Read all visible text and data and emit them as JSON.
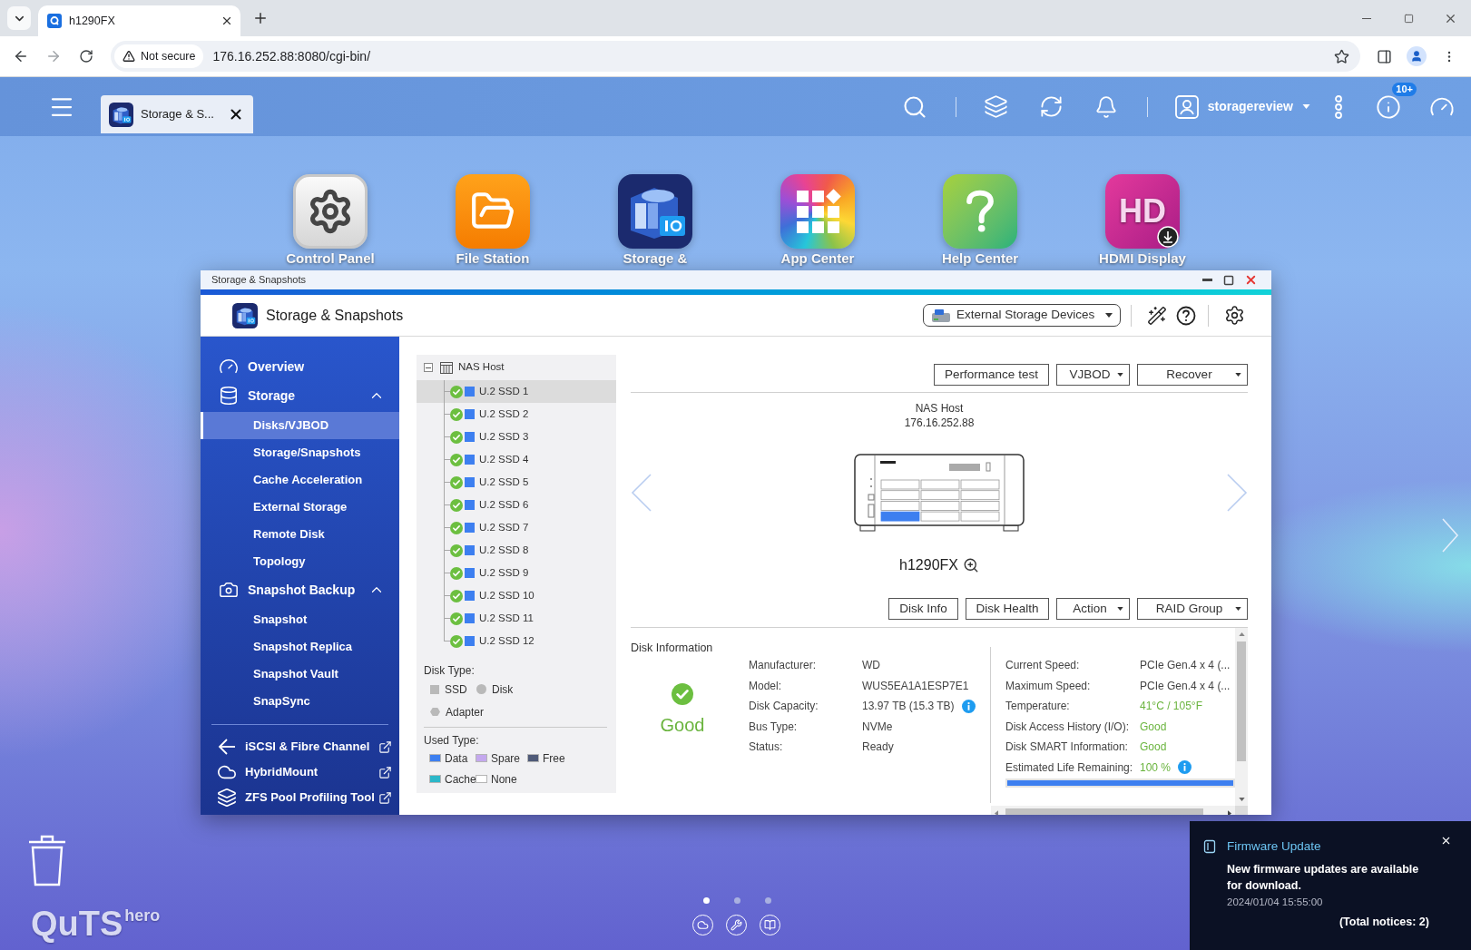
{
  "browser": {
    "tabs": [
      {
        "title": "h1290FX",
        "selected": true
      }
    ],
    "address_bar": {
      "security_label": "Not secure",
      "url": "176.16.252.88:8080/cgi-bin/"
    }
  },
  "top_bar": {
    "taskbar_tabs": [
      {
        "label": "Storage & S...",
        "selected": true
      }
    ],
    "user": "storagereview",
    "notifications_badge": "10+"
  },
  "desktop_icons": [
    {
      "label": "Control Panel"
    },
    {
      "label": "File Station"
    },
    {
      "label": "Storage &"
    },
    {
      "label": "App Center"
    },
    {
      "label": "Help Center"
    },
    {
      "label": "HDMI Display",
      "logo": "HD"
    }
  ],
  "window": {
    "title": "Storage & Snapshots",
    "app_title": "Storage & Snapshots",
    "device_menu": "External Storage Devices",
    "sidebar": {
      "items": [
        {
          "label": "Overview",
          "kind": "page",
          "selected": false
        },
        {
          "label": "Storage",
          "kind": "group",
          "selected": false,
          "expanded": true,
          "children": [
            {
              "label": "Disks/VJBOD",
              "selected": true
            },
            {
              "label": "Storage/Snapshots",
              "selected": false
            },
            {
              "label": "Cache Acceleration",
              "selected": false
            },
            {
              "label": "External Storage",
              "selected": false
            },
            {
              "label": "Remote Disk",
              "selected": false
            },
            {
              "label": "Topology",
              "selected": false
            }
          ]
        },
        {
          "label": "Snapshot Backup",
          "kind": "group",
          "selected": false,
          "expanded": true,
          "children": [
            {
              "label": "Snapshot",
              "selected": false
            },
            {
              "label": "Snapshot Replica",
              "selected": false
            },
            {
              "label": "Snapshot Vault",
              "selected": false
            },
            {
              "label": "SnapSync",
              "selected": false
            }
          ]
        }
      ],
      "links": [
        {
          "label": "iSCSI & Fibre Channel"
        },
        {
          "label": "HybridMount"
        },
        {
          "label": "ZFS Pool Profiling Tool"
        }
      ]
    },
    "tree": {
      "root": {
        "label": "NAS Host",
        "expanded": true,
        "children": [
          {
            "label": "U.2 SSD 1",
            "selected": true,
            "healthy": true,
            "color": "#3d7ff0"
          },
          {
            "label": "U.2 SSD 2",
            "selected": false,
            "healthy": true,
            "color": "#3d7ff0"
          },
          {
            "label": "U.2 SSD 3",
            "selected": false,
            "healthy": true,
            "color": "#3d7ff0"
          },
          {
            "label": "U.2 SSD 4",
            "selected": false,
            "healthy": true,
            "color": "#3d7ff0"
          },
          {
            "label": "U.2 SSD 5",
            "selected": false,
            "healthy": true,
            "color": "#3d7ff0"
          },
          {
            "label": "U.2 SSD 6",
            "selected": false,
            "healthy": true,
            "color": "#3d7ff0"
          },
          {
            "label": "U.2 SSD 7",
            "selected": false,
            "healthy": true,
            "color": "#3d7ff0"
          },
          {
            "label": "U.2 SSD 8",
            "selected": false,
            "healthy": true,
            "color": "#3d7ff0"
          },
          {
            "label": "U.2 SSD 9",
            "selected": false,
            "healthy": true,
            "color": "#3d7ff0"
          },
          {
            "label": "U.2 SSD 10",
            "selected": false,
            "healthy": true,
            "color": "#3d7ff0"
          },
          {
            "label": "U.2 SSD 11",
            "selected": false,
            "healthy": true,
            "color": "#3d7ff0"
          },
          {
            "label": "U.2 SSD 12",
            "selected": false,
            "healthy": true,
            "color": "#3d7ff0"
          }
        ]
      }
    },
    "legend": {
      "disk_type": {
        "title": "Disk Type:",
        "items": [
          {
            "label": "SSD",
            "kind": "square"
          },
          {
            "label": "Disk",
            "kind": "circle"
          },
          {
            "label": "Adapter",
            "kind": "hexagon"
          }
        ]
      },
      "used_type": {
        "title": "Used Type:",
        "items": [
          {
            "label": "Data",
            "color": "#3d7ff0"
          },
          {
            "label": "Spare",
            "color": "#c4a8ee"
          },
          {
            "label": "Free",
            "color": "#4f5a78"
          },
          {
            "label": "Cache",
            "color": "#2bb7c9"
          },
          {
            "label": "None",
            "color": "#ffffff"
          }
        ]
      }
    },
    "toolbar": [
      {
        "label": "Performance test",
        "kind": "button"
      },
      {
        "label": "VJBOD",
        "kind": "dropdown"
      },
      {
        "label": "Recover",
        "kind": "dropdown"
      }
    ],
    "device": {
      "name": "NAS Host",
      "ip": "176.16.252.88",
      "model": "h1290FX",
      "bays": [
        {
          "selected": false
        },
        {
          "selected": false
        },
        {
          "selected": false
        },
        {
          "selected": false
        },
        {
          "selected": false
        },
        {
          "selected": false
        },
        {
          "selected": false
        },
        {
          "selected": false
        },
        {
          "selected": false
        },
        {
          "selected": true
        },
        {
          "selected": false
        },
        {
          "selected": false
        }
      ]
    },
    "disk_actions": [
      {
        "label": "Disk Info",
        "kind": "button"
      },
      {
        "label": "Disk Health",
        "kind": "button"
      },
      {
        "label": "Action",
        "kind": "dropdown"
      },
      {
        "label": "RAID Group",
        "kind": "dropdown"
      }
    ],
    "disk_info": {
      "title": "Disk Information",
      "status": "Good",
      "healthy": true,
      "details": [
        {
          "label": "Manufacturer:",
          "value": "WD",
          "info": false
        },
        {
          "label": "Model:",
          "value": "WUS5EA1A1ESP7E1",
          "info": false
        },
        {
          "label": "Disk Capacity:",
          "value": "13.97 TB (15.3 TB)",
          "info": true
        },
        {
          "label": "Bus Type:",
          "value": "NVMe",
          "info": false
        },
        {
          "label": "Status:",
          "value": "Ready",
          "info": false
        }
      ],
      "health": [
        {
          "label": "Current Speed:",
          "value": "PCIe Gen.4 x 4 (...",
          "kind": "plain",
          "info": false
        },
        {
          "label": "Maximum Speed:",
          "value": "PCIe Gen.4 x 4 (...",
          "kind": "plain",
          "info": false
        },
        {
          "label": "Temperature:",
          "value": "41°C / 105°F",
          "kind": "ok",
          "info": false
        },
        {
          "label": "Disk Access History (I/O):",
          "value": "Good",
          "kind": "ok",
          "info": false
        },
        {
          "label": "Disk SMART Information:",
          "value": "Good",
          "kind": "ok",
          "info": false
        },
        {
          "label": "Estimated Life Remaining:",
          "value": "100 %",
          "kind": "ok",
          "info": true
        }
      ],
      "life": {
        "level": 1
      }
    }
  },
  "notification": {
    "title": "Firmware Update",
    "message": "New firmware updates are available for download.",
    "time": "2024/01/04 15:55:00",
    "total": "(Total notices: 2)"
  },
  "pager": [
    {
      "selected": true
    },
    {
      "selected": false
    },
    {
      "selected": false
    }
  ],
  "brand": {
    "name": "QuTS",
    "edition": "hero"
  }
}
